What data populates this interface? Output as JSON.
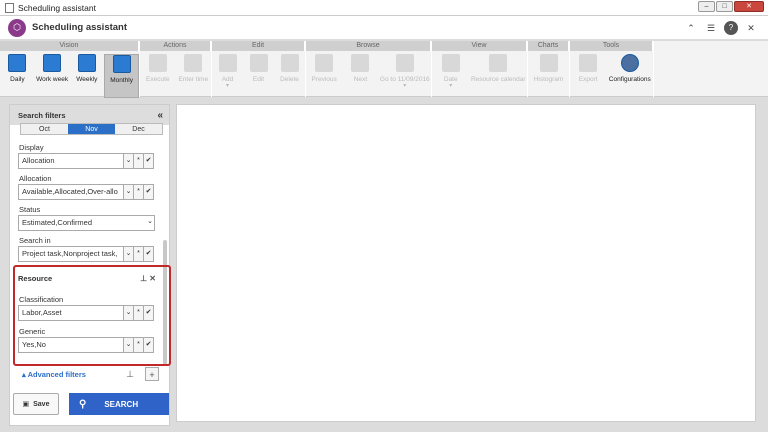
{
  "window": {
    "title": "Scheduling assistant"
  },
  "app": {
    "title": "Scheduling assistant"
  },
  "ribbon": {
    "groups": [
      "Vision",
      "Actions",
      "Edit",
      "Browse",
      "View",
      "Charts",
      "Tools"
    ],
    "vision": [
      "Daily",
      "Work week",
      "Weekly",
      "Monthly"
    ],
    "actions": [
      "Execute",
      "Enter time"
    ],
    "edit": [
      "Add",
      "Edit",
      "Delete"
    ],
    "browse": [
      "Previous",
      "Next",
      "Go to 11/09/2016"
    ],
    "view": [
      "Date",
      "Resource calendar"
    ],
    "charts": [
      "Histogram"
    ],
    "tools": [
      "Export",
      "Configurations"
    ]
  },
  "panel": {
    "title": "Search filters",
    "collapse": "«",
    "months": [
      "Oct",
      "Nov",
      "Dec"
    ],
    "display": {
      "label": "Display",
      "value": "Allocation"
    },
    "allocation": {
      "label": "Allocation",
      "value": "Available,Allocated,Over-allo"
    },
    "status": {
      "label": "Status",
      "value": "Estimated,Confirmed"
    },
    "searchin": {
      "label": "Search in",
      "value": "Project task,Nonproject task,"
    },
    "resource": {
      "title": "Resource"
    },
    "classification": {
      "label": "Classification",
      "value": "Labor,Asset"
    },
    "generic": {
      "label": "Generic",
      "value": "Yes,No"
    },
    "advanced": "Advanced filters",
    "save": "Save",
    "search": "SEARCH"
  },
  "colors": {
    "accent": "#2f63c8",
    "highlight": "#c0282a",
    "logo": "#8b3a8b"
  }
}
